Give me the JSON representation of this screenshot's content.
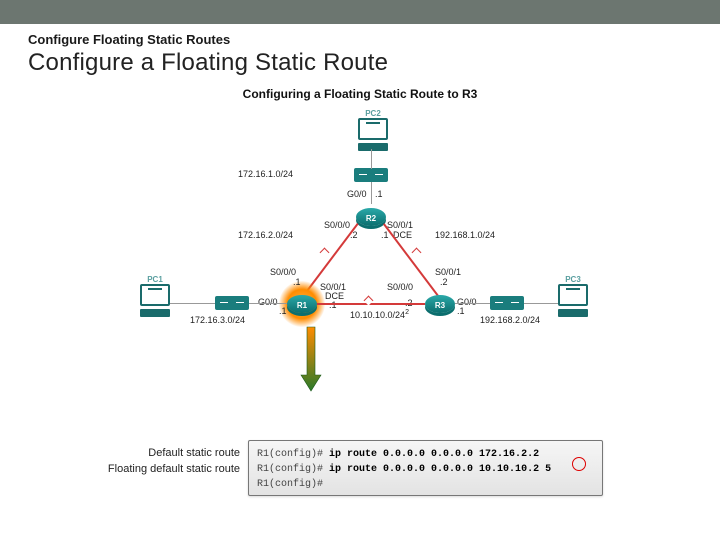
{
  "header": {
    "kicker": "Configure Floating Static Routes",
    "title": "Configure a Floating Static Route"
  },
  "figure": {
    "title": "Configuring a Floating Static Route to R3",
    "pcs": {
      "pc1": "PC1",
      "pc2": "PC2",
      "pc3": "PC3"
    },
    "routers": {
      "r1": "R1",
      "r2": "R2",
      "r3": "R3"
    },
    "ifaces": {
      "r2_g000": "G0/0",
      "r2_dot1_top": ".1",
      "r2_s000": "S0/0/0",
      "r2_dot2_left": ".2",
      "r2_s001": "S0/0/1",
      "r2_dot1_right": ".1",
      "r2_dce": "DCE",
      "r1_s000": "S0/0/0",
      "r1_dot1": ".1",
      "r1_s001": "S0/0/1",
      "r1_s001_dce": "DCE",
      "r1_s001_dot1": ".1",
      "r1_g000": "G0/0",
      "r1_g000_dot1": ".1",
      "r3_s000": "S0/0/0",
      "r3_s000_dot2": ".2",
      "r3_s001": "S0/0/1",
      "r3_s001_dot2": ".2",
      "r3_g000": "G0/0",
      "r3_g000_dot1": ".1"
    },
    "nets": {
      "n1": "172.16.1.0/24",
      "n2": "172.16.2.0/24",
      "n3": "192.168.1.0/24",
      "n4": "172.16.3.0/24",
      "n5": "10.10.10.0/24",
      "n6": "192.168.2.0/24",
      "n5_sup": "2"
    }
  },
  "cli": {
    "prompt": "R1(config)#",
    "cmd1": "ip route 0.0.0.0 0.0.0.0 172.16.2.2",
    "cmd2": "ip route 0.0.0.0 0.0.0.0 10.10.10.2",
    "ad": "5"
  },
  "notes": {
    "line1": "Default static route",
    "line2": "Floating default static route"
  }
}
